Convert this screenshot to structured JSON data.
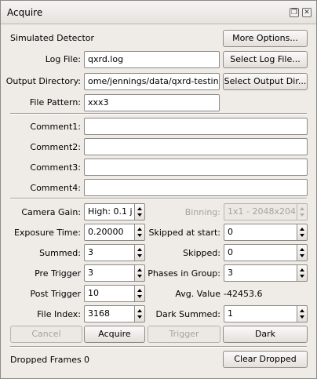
{
  "window": {
    "title": "Acquire"
  },
  "icons": {
    "restore": "restore-icon",
    "close": "close-icon"
  },
  "detector": {
    "label": "Simulated Detector",
    "more_options": "More Options..."
  },
  "log_file": {
    "label": "Log File:",
    "value": "qxrd.log",
    "button": "Select Log File..."
  },
  "output_directory": {
    "label": "Output Directory:",
    "value": "ome/jennings/data/qxrd-testing",
    "button": "Select Output Dir..."
  },
  "file_pattern": {
    "label": "File Pattern:",
    "value": "xxx3"
  },
  "comments": [
    {
      "label": "Comment1:",
      "value": ""
    },
    {
      "label": "Comment2:",
      "value": ""
    },
    {
      "label": "Comment3:",
      "value": ""
    },
    {
      "label": "Comment4:",
      "value": ""
    }
  ],
  "camera_gain": {
    "label": "Camera Gain:",
    "value": "High: 0.1 j"
  },
  "binning": {
    "label": "Binning:",
    "value": "1x1 - 2048x204"
  },
  "exposure_time": {
    "label": "Exposure Time:",
    "value": "0.20000"
  },
  "skipped_at_start": {
    "label": "Skipped at start:",
    "value": "0"
  },
  "summed": {
    "label": "Summed:",
    "value": "3"
  },
  "skipped": {
    "label": "Skipped:",
    "value": "0"
  },
  "pre_trigger": {
    "label": "Pre Trigger",
    "value": "3"
  },
  "phases_in_group": {
    "label": "Phases in Group:",
    "value": "3"
  },
  "post_trigger": {
    "label": "Post Trigger",
    "value": "10"
  },
  "avg_value": {
    "label": "Avg. Value",
    "value": "-42453.6"
  },
  "file_index": {
    "label": "File Index:",
    "value": "3168"
  },
  "dark_summed": {
    "label": "Dark Summed:",
    "value": "1"
  },
  "actions": {
    "cancel": "Cancel",
    "acquire": "Acquire",
    "trigger": "Trigger",
    "dark": "Dark"
  },
  "dropped_frames": {
    "label": "Dropped Frames",
    "value": "0",
    "clear_button": "Clear Dropped"
  },
  "colors": {
    "window_bg": "#efebe7",
    "disabled_text": "#a6a39f"
  }
}
